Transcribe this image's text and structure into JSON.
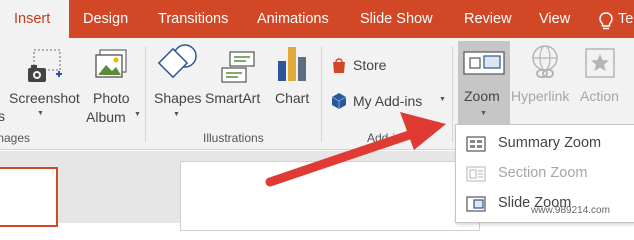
{
  "colors": {
    "accent": "#d24726",
    "ribbon_bg": "#f2f2f2",
    "arrow": "#e03a35"
  },
  "tabs": [
    {
      "label": "Insert",
      "active": true
    },
    {
      "label": "Design"
    },
    {
      "label": "Transitions"
    },
    {
      "label": "Animations"
    },
    {
      "label": "Slide Show"
    },
    {
      "label": "Review"
    },
    {
      "label": "View"
    },
    {
      "label": "Te"
    }
  ],
  "tell_me_icon": "lightbulb-icon",
  "ribbon": {
    "images_group": {
      "label": "mages",
      "cut_label": "s",
      "screenshot_label": "Screenshot",
      "photo_album_line1": "Photo",
      "photo_album_line2": "Album"
    },
    "illustrations_group": {
      "label": "Illustrations",
      "shapes_label": "Shapes",
      "smartart_label": "SmartArt",
      "chart_label": "Chart"
    },
    "addins_group": {
      "label": "Add-i",
      "store_label": "Store",
      "my_addins_label": "My Add-ins"
    },
    "links_group": {
      "zoom_label": "Zoom",
      "hyperlink_label": "Hyperlink",
      "action_label": "Action"
    }
  },
  "zoom_menu": {
    "items": [
      {
        "label": "Summary Zoom",
        "enabled": true,
        "icon": "summary-zoom-icon"
      },
      {
        "label": "Section Zoom",
        "enabled": false,
        "icon": "section-zoom-icon"
      },
      {
        "label": "Slide Zoom",
        "enabled": true,
        "icon": "slide-zoom-icon"
      }
    ]
  },
  "watermark": "www.989214.com"
}
